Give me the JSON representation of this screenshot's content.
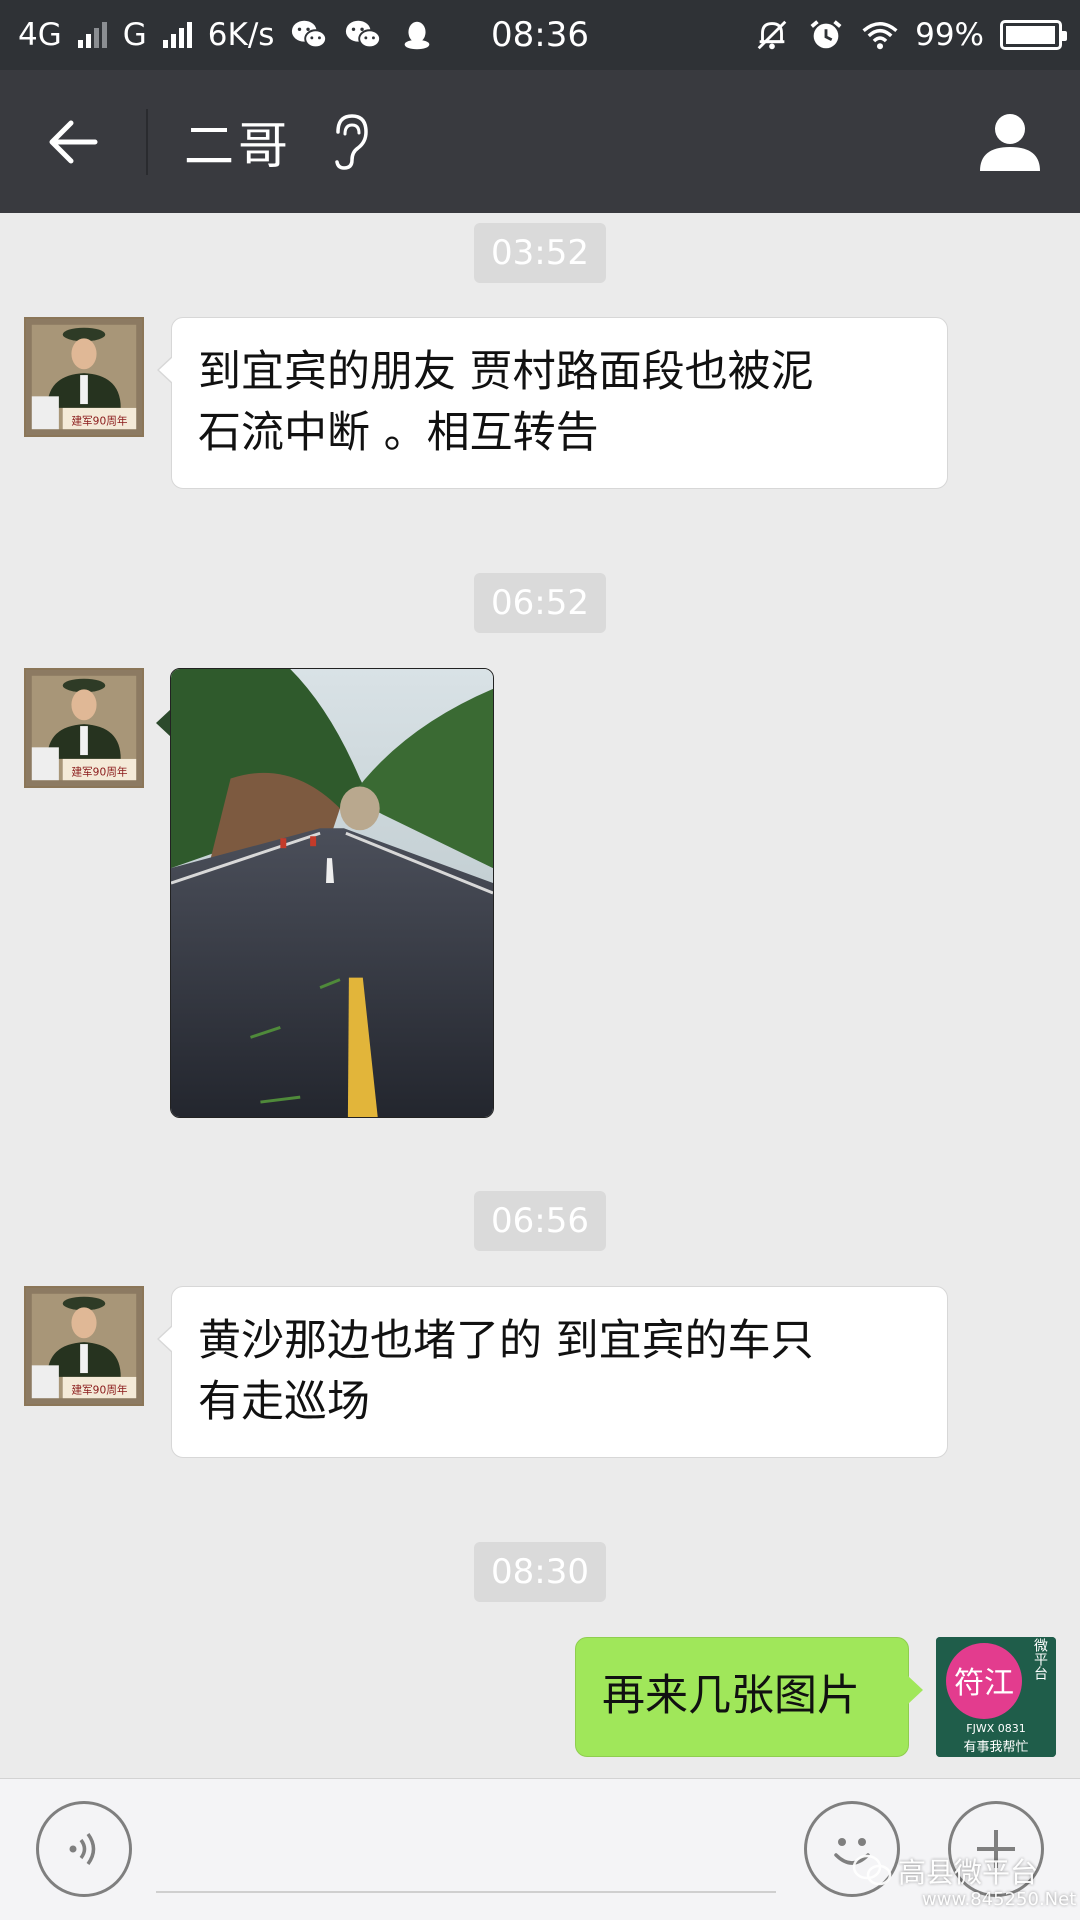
{
  "status_bar": {
    "network1": "4G",
    "network2": "G",
    "speed": "6K/s",
    "time": "08:36",
    "battery": "99%",
    "battery_level": 0.99,
    "icons": [
      "wechat-icon",
      "wechat-icon",
      "qq-penguin-icon",
      "mute-bell-icon",
      "alarm-icon",
      "wifi-icon",
      "battery-icon"
    ]
  },
  "header": {
    "title": "二哥",
    "back_icon": "arrow-left-icon",
    "ear_icon": "earpiece-mode-icon",
    "profile_icon": "person-icon"
  },
  "messages": [
    {
      "type": "timestamp",
      "text": "03:52"
    },
    {
      "type": "text",
      "sender": "contact",
      "lines": [
        "到宜宾的朋友  贾村路面段也被泥",
        "石流中断  。相互转告"
      ]
    },
    {
      "type": "timestamp",
      "text": "06:52"
    },
    {
      "type": "image",
      "sender": "contact",
      "description_icon": "landslide-road-photo"
    },
    {
      "type": "timestamp",
      "text": "06:56"
    },
    {
      "type": "text",
      "sender": "contact",
      "lines": [
        "黄沙那边也堵了的  到宜宾的车只",
        "有走巡场"
      ]
    },
    {
      "type": "timestamp",
      "text": "08:30"
    },
    {
      "type": "text",
      "sender": "me",
      "lines": [
        "再来几张图片"
      ]
    }
  ],
  "my_avatar": {
    "logo_text": "符江",
    "side_text": "微平台",
    "code": "FJWX 0831",
    "slogan": "有事我帮忙"
  },
  "contact_avatar": {
    "caption": "建军90周年"
  },
  "input_bar": {
    "value": "",
    "voice_icon": "voice-icon",
    "emoji_icon": "emoji-icon",
    "plus_icon": "plus-icon"
  },
  "watermark": {
    "text": "高县微平台",
    "url": "www.845250.Net"
  },
  "colors": {
    "header_bg": "#393a3f",
    "status_bg": "#2f3236",
    "chat_bg": "#ebebeb",
    "my_bubble": "#a0e75a",
    "their_bubble": "#ffffff",
    "timestamp_bg": "#dadada"
  }
}
